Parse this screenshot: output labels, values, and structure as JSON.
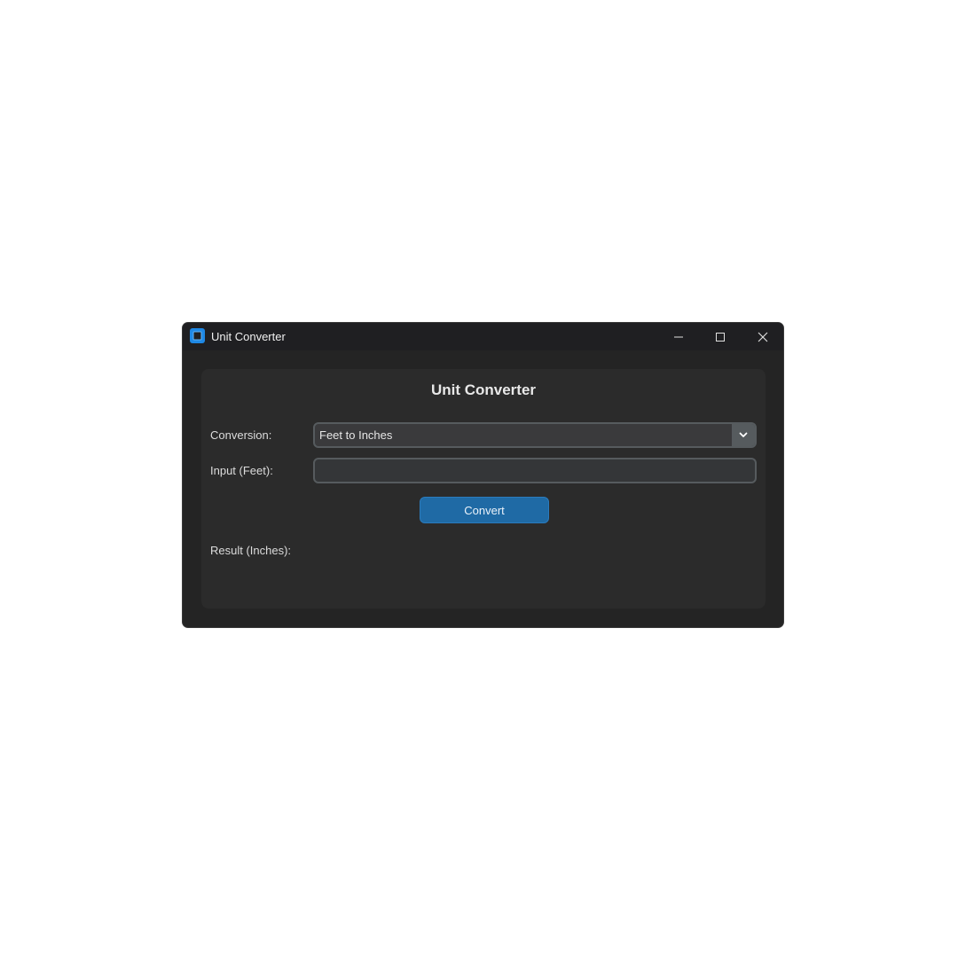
{
  "window": {
    "title": "Unit Converter",
    "accent_color": "#1f6aa5"
  },
  "titlebar": {
    "minimize_icon": "minimize-icon",
    "maximize_icon": "maximize-icon",
    "close_icon": "close-icon"
  },
  "panel": {
    "title": "Unit Converter",
    "conversion_label": "Conversion:",
    "conversion_selected": "Feet to Inches",
    "input_label": "Input (Feet):",
    "input_value": "",
    "input_placeholder": "",
    "convert_label": "Convert",
    "result_label": "Result (Inches):",
    "result_value": ""
  }
}
